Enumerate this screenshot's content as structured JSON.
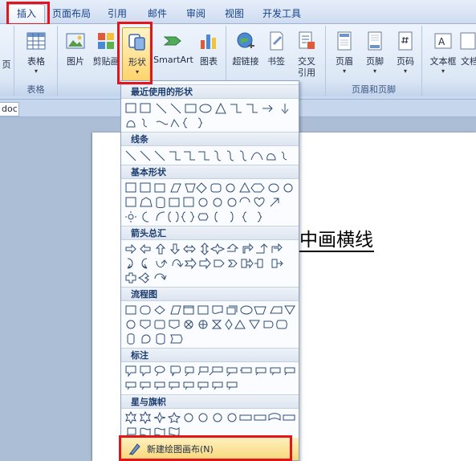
{
  "tabs": [
    "插入",
    "页面布局",
    "引用",
    "邮件",
    "审阅",
    "视图",
    "开发工具"
  ],
  "active_tab": "插入",
  "ribbon": {
    "buttons": {
      "page": "页",
      "table": "表格",
      "picture": "图片",
      "clipart": "剪贴画",
      "shapes": "形状",
      "smartart": "SmartArt",
      "chart": "图表",
      "hyperlink": "超链接",
      "bookmark": "书签",
      "crossref_1": "交叉",
      "crossref_2": "引用",
      "header": "页眉",
      "footer": "页脚",
      "pagenum": "页码",
      "textbox": "文本框",
      "more": "文档"
    },
    "groups": {
      "tables": "表格",
      "header_footer": "页眉和页脚"
    }
  },
  "document": {
    "tab_label": "doc",
    "text": "中画横线"
  },
  "shapes_menu": {
    "sections": [
      "最近使用的形状",
      "线条",
      "基本形状",
      "箭头总汇",
      "流程图",
      "标注",
      "星与旗帜"
    ],
    "footer_label": "新建绘图画布(N)"
  },
  "colors": {
    "highlight_red": "#e3151a",
    "ribbon_accent": "#15428b",
    "menu_footer": "#f8d77a"
  }
}
